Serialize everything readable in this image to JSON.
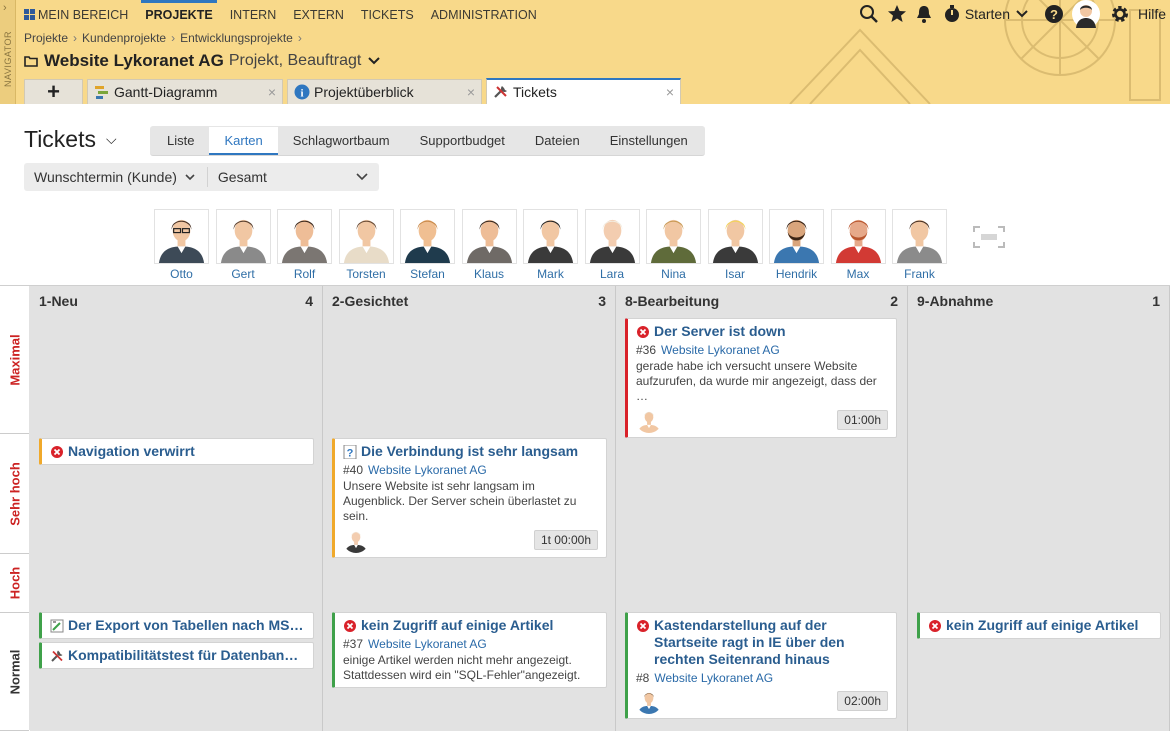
{
  "navigator_label": "NAVIGATOR",
  "topnav": {
    "items": [
      {
        "label": "MEIN BEREICH",
        "active": false,
        "icon": "grid-icon"
      },
      {
        "label": "PROJEKTE",
        "active": true
      },
      {
        "label": "INTERN",
        "active": false
      },
      {
        "label": "EXTERN",
        "active": false
      },
      {
        "label": "TICKETS",
        "active": false
      },
      {
        "label": "ADMINISTRATION",
        "active": false
      }
    ],
    "start_label": "Starten",
    "help_label": "Hilfe"
  },
  "breadcrumb": [
    "Projekte",
    "Kundenprojekte",
    "Entwicklungsprojekte"
  ],
  "project": {
    "name": "Website Lykoranet AG",
    "status": "Projekt, Beauftragt"
  },
  "project_tabs": [
    {
      "label": "Gantt-Diagramm",
      "icon": "gantt-icon",
      "selected": false
    },
    {
      "label": "Projektüberblick",
      "icon": "info-icon",
      "selected": false
    },
    {
      "label": "Tickets",
      "icon": "tools-icon",
      "selected": true
    }
  ],
  "page_title": "Tickets",
  "view_tabs": [
    {
      "label": "Liste",
      "selected": false
    },
    {
      "label": "Karten",
      "selected": true
    },
    {
      "label": "Schlagwortbaum",
      "selected": false
    },
    {
      "label": "Supportbudget",
      "selected": false
    },
    {
      "label": "Dateien",
      "selected": false
    },
    {
      "label": "Einstellungen",
      "selected": false
    }
  ],
  "filter": {
    "field": "Wunschtermin (Kunde)",
    "value": "Gesamt"
  },
  "people": [
    {
      "name": "Otto",
      "skin": "#f1c7a3",
      "hair": "#4a3325",
      "shirt": "#3d4a57",
      "glasses": true
    },
    {
      "name": "Gert",
      "skin": "#f1c7a3",
      "hair": "#5a4130",
      "shirt": "#8a8a8a"
    },
    {
      "name": "Rolf",
      "skin": "#eebd97",
      "hair": "#3e2b1f",
      "shirt": "#7b7672"
    },
    {
      "name": "Torsten",
      "skin": "#f1c7a3",
      "hair": "#6b4d36",
      "shirt": "#e8dcc8"
    },
    {
      "name": "Stefan",
      "skin": "#f0bf92",
      "hair": "#c98a4a",
      "shirt": "#1f3b4d"
    },
    {
      "name": "Klaus",
      "skin": "#eebd97",
      "hair": "#3a2a20",
      "shirt": "#6f6a66"
    },
    {
      "name": "Mark",
      "skin": "#f1c7a3",
      "hair": "#262626",
      "shirt": "#3a3a3a"
    },
    {
      "name": "Lara",
      "skin": "#f3cdb0",
      "hair": "#f3ece0",
      "shirt": "#3a3a3a"
    },
    {
      "name": "Nina",
      "skin": "#f1c7a3",
      "hair": "#c99a55",
      "shirt": "#5f6b3a"
    },
    {
      "name": "Isar",
      "skin": "#f1c7a3",
      "hair": "#f2d35a",
      "shirt": "#3a3a3a"
    },
    {
      "name": "Hendrik",
      "skin": "#d9a57c",
      "hair": "#3a2415",
      "shirt": "#3b77b0",
      "beard": true
    },
    {
      "name": "Max",
      "skin": "#e6a98a",
      "hair": "#b8562f",
      "shirt": "#d23a34",
      "beard": true
    },
    {
      "name": "Frank",
      "skin": "#f1c7a3",
      "hair": "#4a3325",
      "shirt": "#8b8b8b"
    }
  ],
  "lanes": [
    {
      "label": "Maximal"
    },
    {
      "label": "Sehr hoch"
    },
    {
      "label": "Hoch"
    },
    {
      "label": "Normal"
    }
  ],
  "columns": [
    {
      "title": "1-Neu",
      "count": "4"
    },
    {
      "title": "2-Gesichtet",
      "count": "3"
    },
    {
      "title": "8-Bearbeitung",
      "count": "2"
    },
    {
      "title": "9-Abnahme",
      "count": "1"
    }
  ],
  "cards": {
    "c36": {
      "title": "Der Server ist down",
      "icon": "error-icon",
      "id": "#36",
      "project": "Website Lykoranet AG",
      "desc": "gerade habe ich versucht unsere Website aufzurufen, da wurde mir angezeigt, dass der …",
      "time": "01:00h"
    },
    "cnav": {
      "title": "Navigation verwirrt",
      "icon": "error-icon"
    },
    "c40": {
      "title": "Die Verbindung ist sehr langsam",
      "icon": "question-icon",
      "id": "#40",
      "project": "Website Lykoranet AG",
      "desc": "Unsere Website ist sehr langsam im Augenblick. Der Server schein überlastet zu sein.",
      "time": "1t 00:00h"
    },
    "cexport": {
      "title": "Der Export von Tabellen nach MS…",
      "icon": "edit-icon"
    },
    "ckompat": {
      "title": "Kompatibilitätstest für Datenban…",
      "icon": "tools-icon"
    },
    "c37": {
      "title": "kein Zugriff auf einige Artikel",
      "icon": "error-icon",
      "id": "#37",
      "project": "Website Lykoranet AG",
      "desc": "einige Artikel werden nicht mehr angezeigt. Stattdessen wird ein \"SQL-Fehler\"angezeigt."
    },
    "c8": {
      "title": "Kastendarstellung auf der Startseite ragt in IE über den rechten Seitenrand hinaus",
      "icon": "error-icon",
      "id": "#8",
      "project": "Website Lykoranet AG",
      "time": "02:00h"
    },
    "cabn": {
      "title": "kein Zugriff auf einige Artikel",
      "icon": "error-icon"
    }
  }
}
